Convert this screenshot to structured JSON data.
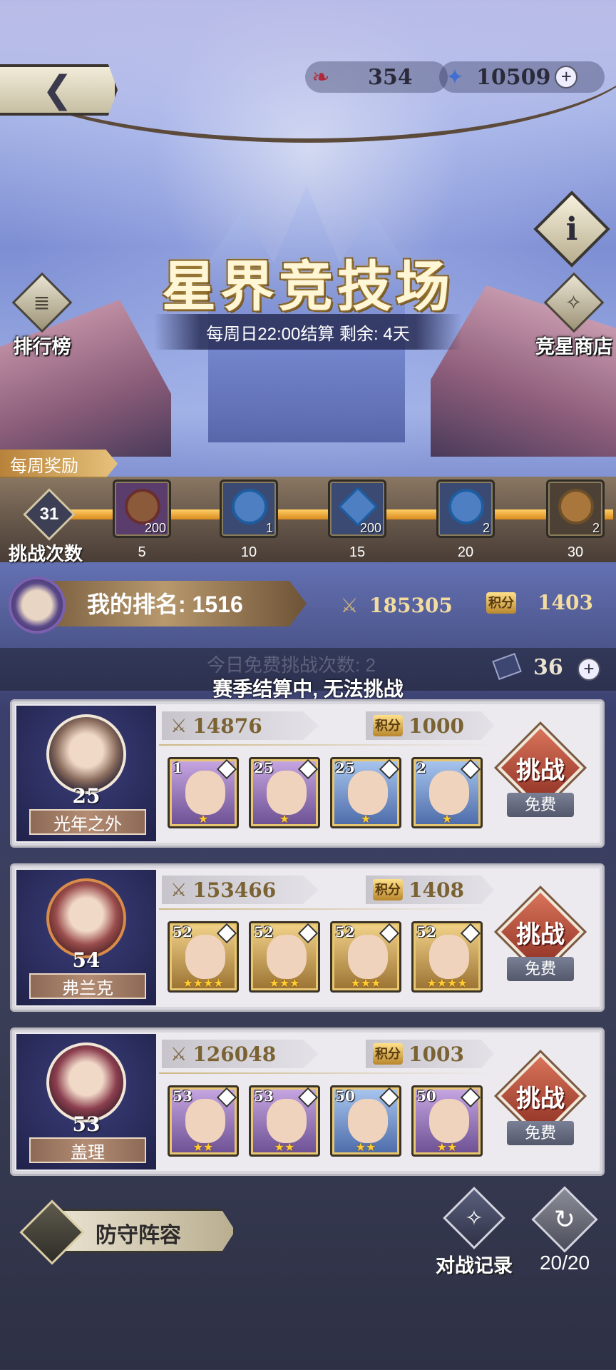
{
  "resources": {
    "stamina": {
      "icon": "dragon-ticket-icon",
      "value": "354"
    },
    "gems": {
      "icon": "star-crystal-icon",
      "value": "10509"
    },
    "add_label": "+"
  },
  "header": {
    "back_icon": "back-arrow-icon",
    "title": "星界竞技场",
    "subtitle": "每周日22:00结算  剩余: 4天",
    "info_label": "i"
  },
  "side": {
    "leaderboard_label": "排行榜",
    "shop_label": "竞星商店"
  },
  "weekly": {
    "tab_label": "每周奖励",
    "challenge_count": "31",
    "challenge_label": "挑战次数",
    "rewards": [
      {
        "step": "5",
        "qty": "200",
        "type": "purple"
      },
      {
        "step": "10",
        "qty": "1",
        "type": "blue"
      },
      {
        "step": "15",
        "qty": "200",
        "type": "blue"
      },
      {
        "step": "20",
        "qty": "2",
        "type": "blue"
      },
      {
        "step": "30",
        "qty": "2",
        "type": "brown"
      }
    ]
  },
  "my_rank": {
    "label": "我的排名: 1516",
    "power": "185305",
    "score_badge": "积分",
    "score": "1403"
  },
  "free_bar": {
    "ghost_text": "今日免费挑战次数: 2",
    "tickets": "36",
    "notice": "赛季结算中, 无法挑战"
  },
  "opponents": [
    {
      "name": "光年之外",
      "level": "25",
      "power": "14876",
      "score": "1000",
      "heroes": [
        {
          "level": "1",
          "stars": "★",
          "color": "purple"
        },
        {
          "level": "25",
          "stars": "★",
          "color": "purple"
        },
        {
          "level": "25",
          "stars": "★",
          "color": "blue"
        },
        {
          "level": "2",
          "stars": "★",
          "color": "blue"
        }
      ]
    },
    {
      "name": "弗兰克",
      "level": "54",
      "power": "153466",
      "score": "1408",
      "heroes": [
        {
          "level": "52",
          "stars": "★★★★",
          "color": "gold"
        },
        {
          "level": "52",
          "stars": "★★★",
          "color": "gold"
        },
        {
          "level": "52",
          "stars": "★★★",
          "color": "gold"
        },
        {
          "level": "52",
          "stars": "★★★★",
          "color": "gold"
        }
      ]
    },
    {
      "name": "盖理",
      "level": "53",
      "power": "126048",
      "score": "1003",
      "heroes": [
        {
          "level": "53",
          "stars": "★★",
          "color": "purple"
        },
        {
          "level": "53",
          "stars": "★★",
          "color": "purple"
        },
        {
          "level": "50",
          "stars": "★★",
          "color": "blue"
        },
        {
          "level": "50",
          "stars": "★★",
          "color": "purple"
        }
      ]
    }
  ],
  "card_common": {
    "score_badge": "积分",
    "challenge_label": "挑战",
    "free_label": "免费"
  },
  "bottom": {
    "defense_label": "防守阵容",
    "record_label": "对战记录",
    "refresh_count": "20/20"
  }
}
